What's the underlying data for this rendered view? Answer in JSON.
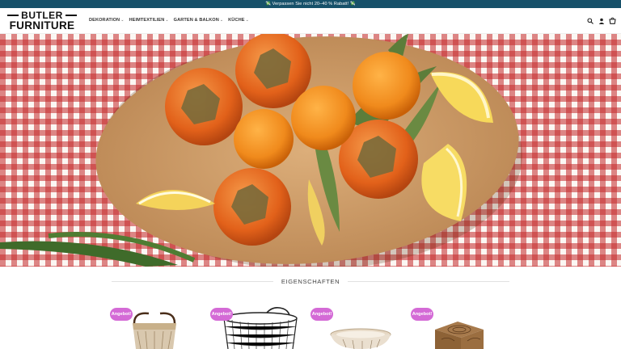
{
  "announcement": "💸 Verpassen Sie nicht 20–40 % Rabatt! 💸",
  "logo": {
    "line1": "BUTLER",
    "line2": "FURNITURE"
  },
  "nav": [
    {
      "label": "DEKORATION"
    },
    {
      "label": "HEIMTEXTILIEN"
    },
    {
      "label": "GARTEN & BALKON"
    },
    {
      "label": "KÜCHE"
    }
  ],
  "header_icons": [
    "search-icon",
    "account-icon",
    "cart-icon"
  ],
  "section_title": "EIGENSCHAFTEN",
  "products": [
    {
      "badge": "Angebot!",
      "image": "woven-basket-image"
    },
    {
      "badge": "Angebot!",
      "image": "wire-basket-image"
    },
    {
      "badge": "Angebot!",
      "image": "bowl-image"
    },
    {
      "badge": "Angebot!",
      "image": "carved-box-image"
    }
  ],
  "colors": {
    "topbar": "#17516a",
    "badge": "#d46ad6",
    "gingham": "#c42828"
  }
}
